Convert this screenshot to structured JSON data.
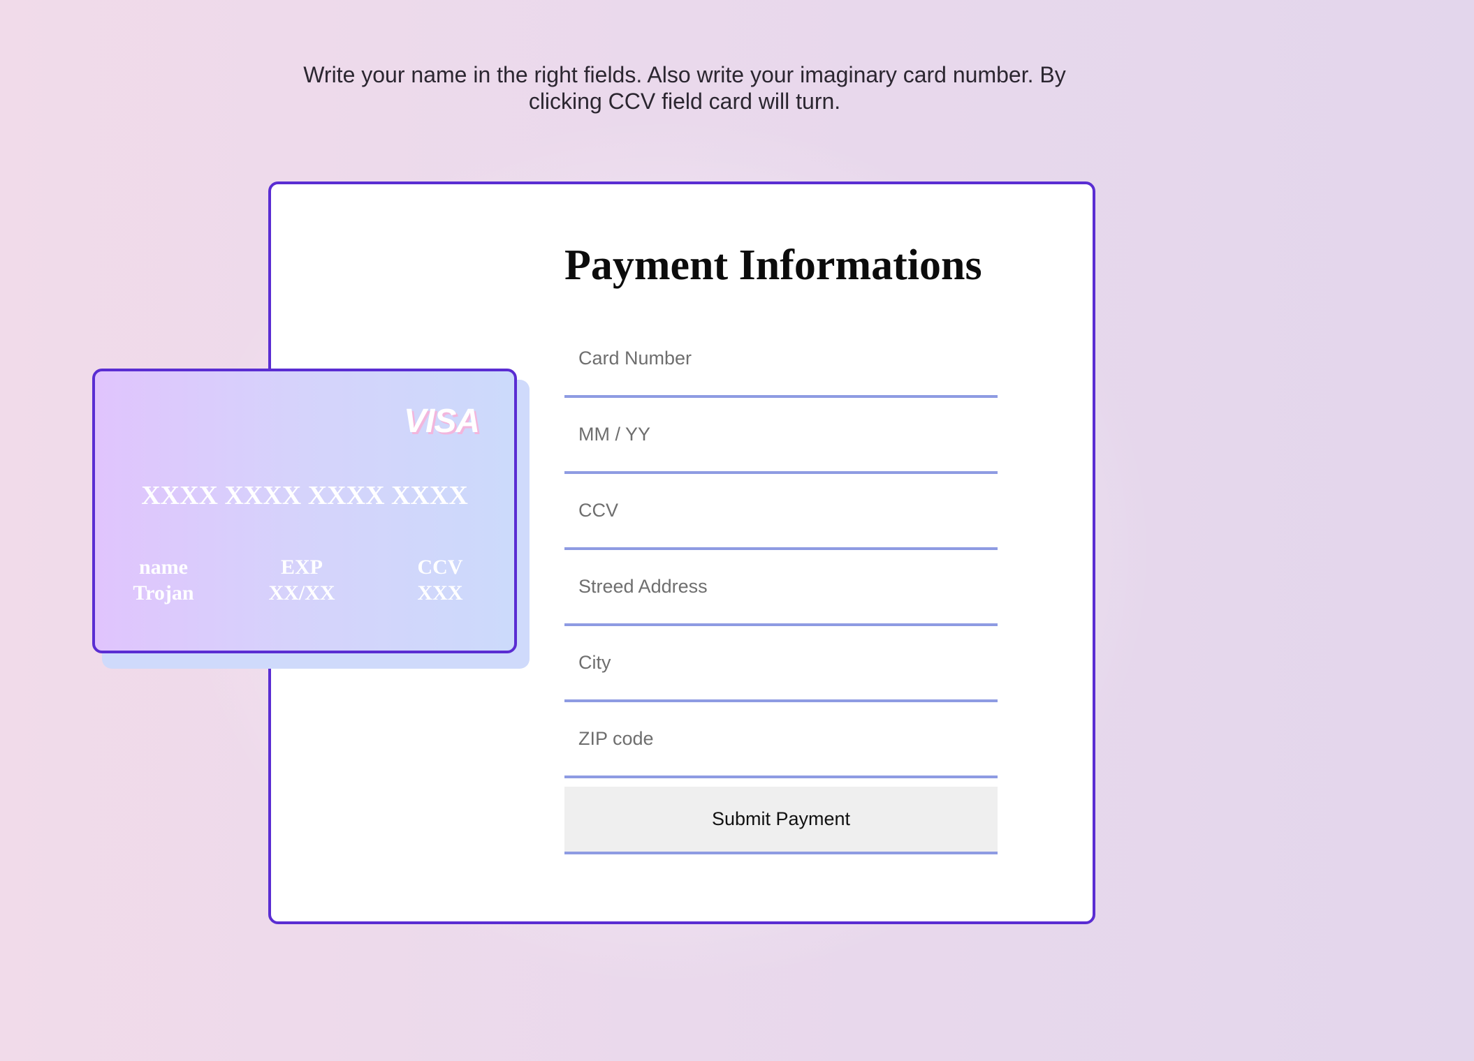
{
  "instructions": "Write your name in the right fields. Also write your imaginary card number. By clicking CCV field card will turn.",
  "form": {
    "title": "Payment Informations",
    "fields": {
      "card_number": "Card Number",
      "expiry": "MM / YY",
      "ccv": "CCV",
      "address": "Streed Address",
      "city": "City",
      "zip": "ZIP code"
    },
    "submit_label": "Submit Payment"
  },
  "card": {
    "brand": "VISA",
    "number": "XXXX XXXX XXXX XXXX",
    "name_label": "name",
    "name_value": "Trojan",
    "exp_label": "EXP",
    "exp_value": "XX/XX",
    "ccv_label": "CCV",
    "ccv_value": "XXX"
  },
  "colors": {
    "accent": "#5a2dd2",
    "underline": "#8e9be2",
    "card_gradient_start": "#e0c4fd",
    "card_gradient_end": "#ccdafb",
    "card_shadow": "#cfdafb"
  }
}
